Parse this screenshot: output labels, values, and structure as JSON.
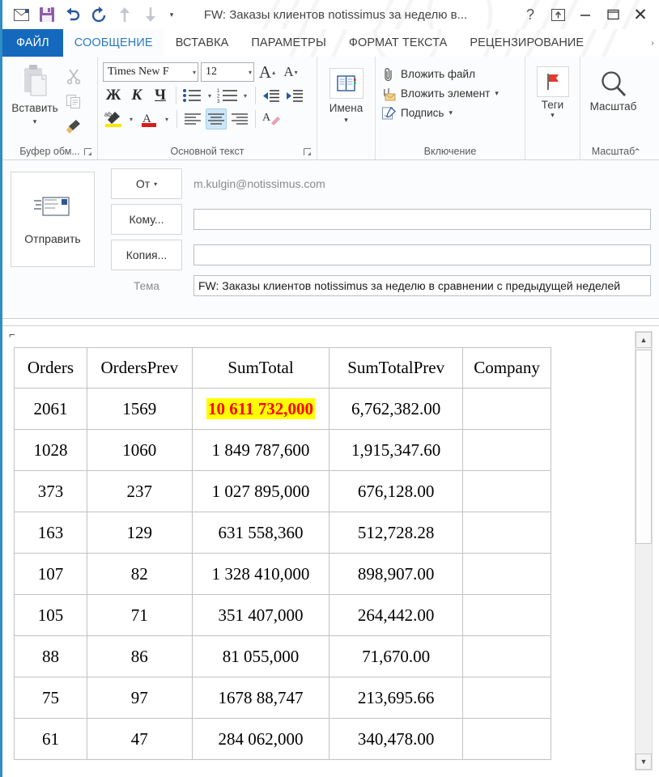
{
  "window": {
    "title": "FW: Заказы клиентов notissimus за неделю в...",
    "qat": [
      {
        "name": "message-icon",
        "label": "Сообщение"
      },
      {
        "name": "save-icon",
        "label": "Сохранить"
      },
      {
        "name": "undo-icon",
        "label": "Отменить"
      },
      {
        "name": "redo-icon",
        "label": "Вернуть"
      },
      {
        "name": "previous-item-icon",
        "label": "Предыдущий элемент"
      },
      {
        "name": "next-item-icon",
        "label": "Следующий элемент"
      },
      {
        "name": "customize-qat-caret",
        "label": "▾"
      }
    ],
    "controls": {
      "help": "?",
      "ribbon_options": "ribbon-display-options-icon",
      "minimize": "—",
      "maximize": "▢",
      "close": "✕"
    }
  },
  "tabs": [
    {
      "label": "ФАЙЛ",
      "active": false,
      "file": true
    },
    {
      "label": "СООБЩЕНИЕ",
      "active": true,
      "file": false
    },
    {
      "label": "ВСТАВКА",
      "active": false,
      "file": false
    },
    {
      "label": "ПАРАМЕТРЫ",
      "active": false,
      "file": false
    },
    {
      "label": "ФОРМАТ ТЕКСТА",
      "active": false,
      "file": false
    },
    {
      "label": "РЕЦЕНЗИРОВАНИЕ",
      "active": false,
      "file": false
    }
  ],
  "tab_overflow": "›",
  "ribbon": {
    "clipboard": {
      "group_label": "Буфер обм...",
      "paste_label": "Вставить",
      "paste_caret": "▾",
      "cut_label": "Вырезать",
      "copy_label": "Копировать",
      "format_painter_label": "Формат по образцу",
      "launcher": "⌐"
    },
    "basic_text": {
      "group_label": "Основной текст",
      "font_name": "Times New F",
      "font_size": "12",
      "grow_font": "A",
      "shrink_font": "A",
      "bold": "Ж",
      "italic": "К",
      "underline": "Ч",
      "bullets_label": "Маркеры",
      "numbering_label": "Нумерация",
      "decrease_indent_label": "Уменьшить отступ",
      "increase_indent_label": "Увеличить отступ",
      "highlight_label": "Цвет выделения текста",
      "fontcolor_label": "Цвет шрифта",
      "align_left_label": "По левому краю",
      "align_center_label": "По центру",
      "align_right_label": "По правому краю",
      "clear_format_label": "Очистить формат",
      "launcher": "⌐"
    },
    "names": {
      "group_label": "",
      "address_book_label": "Имена",
      "caret": "▾"
    },
    "include": {
      "group_label": "Включение",
      "items": [
        {
          "label": "Вложить файл",
          "icon": "paperclip-icon",
          "caret": ""
        },
        {
          "label": "Вложить элемент",
          "icon": "attach-item-icon",
          "caret": "▾"
        },
        {
          "label": "Подпись",
          "icon": "signature-icon",
          "caret": "▾"
        }
      ]
    },
    "tags": {
      "group_label": "",
      "label": "Теги",
      "caret": "▾",
      "icon": "flag-icon"
    },
    "zoom": {
      "group_label": "Масштаб",
      "label": "Масштаб",
      "icon": "magnifier-icon"
    },
    "collapse": "⌃"
  },
  "compose": {
    "send_label": "Отправить",
    "from_button": "От",
    "from_caret": "▾",
    "from_value": "m.kulgin@notissimus.com",
    "to_button": "Кому...",
    "to_value": "",
    "cc_button": "Копия...",
    "cc_value": "",
    "subject_label": "Тема",
    "subject_value": "FW: Заказы клиентов notissimus за неделю в сравнении с предыдущей неделей"
  },
  "body": {
    "move_handle": "⌐",
    "table": {
      "columns": [
        "Orders",
        "OrdersPrev",
        "SumTotal",
        "SumTotalPrev",
        "Company"
      ],
      "rows": [
        {
          "orders": "2061",
          "ordersPrev": "1569",
          "sumTotal": "10 611 732,000",
          "sumTotalPrev": "6,762,382.00",
          "company": "",
          "highlight": true
        },
        {
          "orders": "1028",
          "ordersPrev": "1060",
          "sumTotal": "1 849 787,600",
          "sumTotalPrev": "1,915,347.60",
          "company": "",
          "highlight": false
        },
        {
          "orders": "373",
          "ordersPrev": "237",
          "sumTotal": "1 027 895,000",
          "sumTotalPrev": "676,128.00",
          "company": "",
          "highlight": false
        },
        {
          "orders": "163",
          "ordersPrev": "129",
          "sumTotal": "631 558,360",
          "sumTotalPrev": "512,728.28",
          "company": "",
          "highlight": false
        },
        {
          "orders": "107",
          "ordersPrev": "82",
          "sumTotal": "1 328 410,000",
          "sumTotalPrev": "898,907.00",
          "company": "",
          "highlight": false
        },
        {
          "orders": "105",
          "ordersPrev": "71",
          "sumTotal": "351 407,000",
          "sumTotalPrev": "264,442.00",
          "company": "",
          "highlight": false
        },
        {
          "orders": "88",
          "ordersPrev": "86",
          "sumTotal": "81 055,000",
          "sumTotalPrev": "71,670.00",
          "company": "",
          "highlight": false
        },
        {
          "orders": "75",
          "ordersPrev": "97",
          "sumTotal": "1678 88,747",
          "sumTotalPrev": "213,695.66",
          "company": "",
          "highlight": false
        },
        {
          "orders": "61",
          "ordersPrev": "47",
          "sumTotal": "284 062,000",
          "sumTotalPrev": "340,478.00",
          "company": "",
          "highlight": false
        }
      ]
    },
    "scrollbar": {
      "up": "▲",
      "down": "▼"
    }
  },
  "colors": {
    "file_tab": "#1569bd",
    "active_tab_text": "#2b79c2",
    "highlight_bg": "#ffff00",
    "highlight_text": "#ff0000",
    "accent_border": "#2d8fc4"
  }
}
